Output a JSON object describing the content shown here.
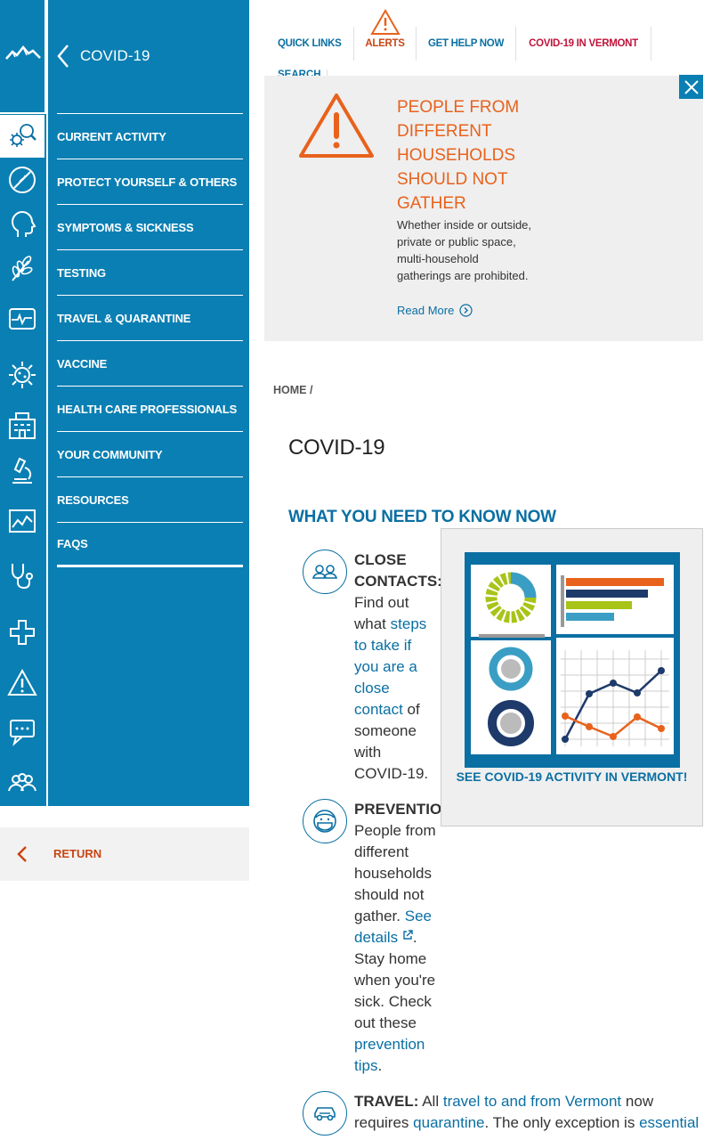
{
  "sidebar": {
    "title": "COVID-19",
    "items": [
      {
        "label": "CURRENT ACTIVITY"
      },
      {
        "label": "PROTECT YOURSELF & OTHERS"
      },
      {
        "label": "SYMPTOMS & SICKNESS"
      },
      {
        "label": "TESTING"
      },
      {
        "label": "TRAVEL & QUARANTINE"
      },
      {
        "label": "VACCINE"
      },
      {
        "label": "HEALTH CARE PROFESSIONALS"
      },
      {
        "label": "YOUR COMMUNITY"
      },
      {
        "label": "RESOURCES"
      },
      {
        "label": "FAQS"
      }
    ],
    "return_label": "RETURN",
    "rail_icons": [
      "mountain-logo-icon",
      "virus-search-icon",
      "no-touch-face-icon",
      "head-profile-icon",
      "wheat-icon",
      "heart-monitor-icon",
      "sun-virus-icon",
      "building-icon",
      "microscope-icon",
      "chart-icon",
      "stethoscope-icon",
      "medical-cross-icon",
      "warning-icon",
      "chat-icon",
      "community-icon"
    ]
  },
  "topnav": {
    "quick_links": "QUICK LINKS",
    "alerts": "ALERTS",
    "get_help": "GET HELP NOW",
    "covid_vt": "COVID-19 IN VERMONT",
    "search": "SEARCH"
  },
  "alert": {
    "title": "PEOPLE FROM DIFFERENT HOUSEHOLDS SHOULD NOT GATHER",
    "body": "Whether inside or outside, private or public space, multi-household gatherings are prohibited.",
    "read_more": "Read More"
  },
  "breadcrumb": {
    "home": "HOME",
    "sep": "/"
  },
  "page": {
    "title": "COVID-19",
    "section_title": "WHAT YOU NEED TO KNOW NOW"
  },
  "items": {
    "close": {
      "heading": "CLOSE CONTACTS:",
      "t1": "Find out what",
      "link": "steps to take if you are a close contact",
      "t2": "of someone with COVID-19."
    },
    "prevention": {
      "heading": "PREVENTION:",
      "t1": "People from different households should not gather.",
      "link1": "See details",
      "t2": ". Stay home when you're sick. Check out these",
      "link2": "prevention tips",
      "t3": "."
    },
    "travel": {
      "heading": "TRAVEL:",
      "t1": "All",
      "link1": "travel to and from Vermont",
      "t2": "now requires",
      "link2": "quarantine",
      "t3": ". The only exception is",
      "link3": "essential"
    }
  },
  "card": {
    "link": "SEE COVID-19 ACTIVITY IN VERMONT!"
  },
  "colors": {
    "brand_blue": "#0a7fb3",
    "link_blue": "#0a6fa3",
    "alert_orange": "#e8621c",
    "alert_red": "#c0143c"
  }
}
